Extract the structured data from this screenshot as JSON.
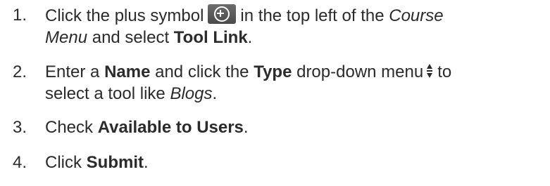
{
  "steps": [
    {
      "num": "1.",
      "t1": "Click the plus symbol",
      "t2": "in the top left of the",
      "course_menu": "Course",
      "menu": "Menu",
      "t3": "and select",
      "tool_link": "Tool Link",
      "end": "."
    },
    {
      "num": "2.",
      "t1": "Enter a",
      "name": "Name",
      "t2": "and click the",
      "type": "Type",
      "t3": "drop-down menu",
      "t4": "to",
      "t5": "select a tool like",
      "blogs": "Blogs",
      "end": "."
    },
    {
      "num": "3.",
      "t1": "Check",
      "available": "Available to Users",
      "end": "."
    },
    {
      "num": "4.",
      "t1": "Click",
      "submit": "Submit",
      "end": "."
    }
  ],
  "icons": {
    "plus": "plus-circle-icon",
    "updown": "up-down-arrows-icon"
  }
}
